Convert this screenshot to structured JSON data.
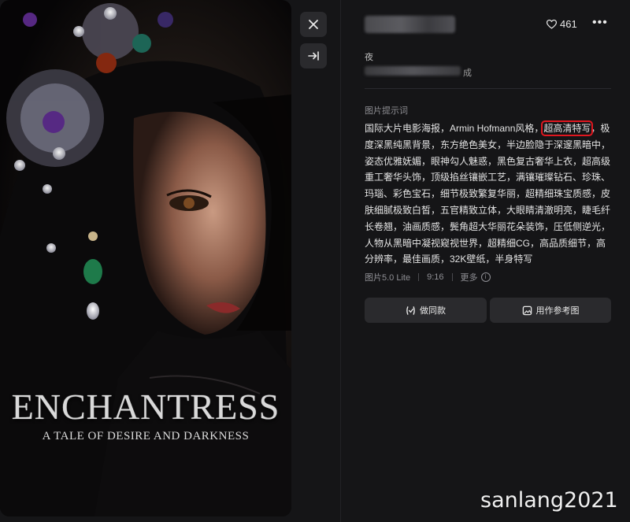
{
  "poster": {
    "title": "ENCHANTRESS",
    "subtitle": "A TALE OF DESIRE AND DARKNESS"
  },
  "toolbar": {
    "close_icon": "close-icon",
    "collapse_icon": "collapse-right-icon"
  },
  "header": {
    "likes": "461",
    "like_icon": "heart-icon",
    "more_icon": "more-horizontal-icon"
  },
  "work": {
    "name": "夜",
    "status": "成"
  },
  "prompt": {
    "heading": "图片提示词",
    "before_highlight": "国际大片电影海报，Armin Hofmann风格，",
    "highlight": "超高清特写",
    "after_highlight": "，极度深黑纯黑背景，东方绝色美女，半边脸隐于深邃黑暗中，姿态优雅妩媚，眼神勾人魅惑，黑色复古奢华上衣，超高级重工奢华头饰，顶级掐丝镶嵌工艺，满镶璀璨钻石、珍珠、玛瑙、彩色宝石，细节极致繁复华丽，超精细珠宝质感，皮肤细腻极致白皙，五官精致立体，大眼睛清澈明亮，睫毛纤长卷翘，油画质感，鬓角超大华丽花朵装饰，压低侧逆光，人物从黑暗中凝视窥视世界，超精细CG，高品质细节，高分辨率，最佳画质，32K壁纸，半身特写",
    "highlight_color": "#e0171f"
  },
  "meta": {
    "model": "图片5.0 Lite",
    "ratio": "9:16",
    "more": "更多"
  },
  "actions": {
    "make_same": "做同款",
    "use_reference": "用作参考图"
  },
  "watermark": "sanlang2021"
}
